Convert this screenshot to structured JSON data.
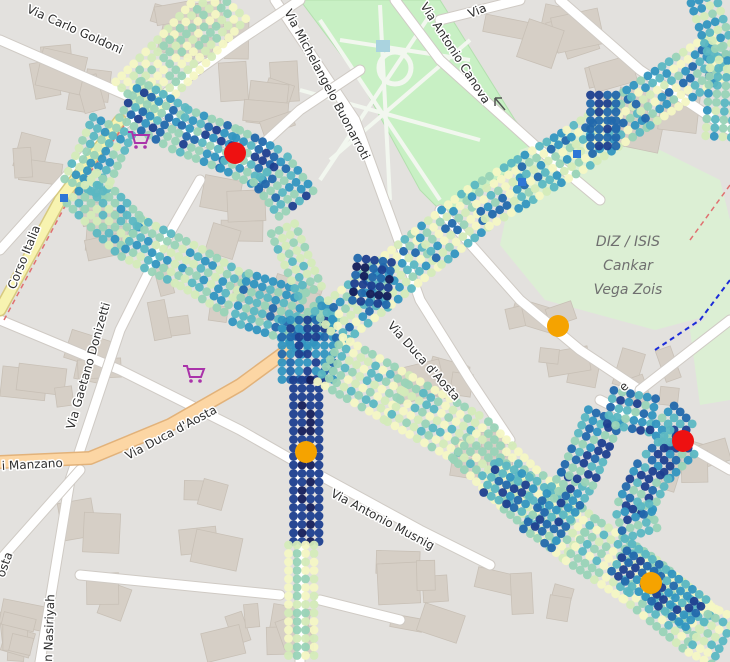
{
  "map": {
    "colors": {
      "background": "#e3e1de",
      "building": "#d6cfc6",
      "building_stroke": "#c8c0b6",
      "park": "#c8f0c4",
      "park_light": "#dcefd4",
      "road": "#ffffff",
      "primary_road": "#fcd6a4",
      "primary_road_stroke": "#e2b27a",
      "rail": "#999999",
      "boundary": "#1b2bd8",
      "point_red": "#ee1111",
      "point_orange": "#f5a300",
      "shop_icon": "#aa33aa",
      "bus_icon": "#2f77d6"
    },
    "heat_palette": [
      "#f4f7c4",
      "#d4ebb9",
      "#99d3b7",
      "#5bb7c2",
      "#3195c0",
      "#2268ac",
      "#1d3f8f",
      "#141e5a"
    ],
    "streets": [
      {
        "name": "Via Carlo Goldoni"
      },
      {
        "name": "Via Michelangelo Buonarroti"
      },
      {
        "name": "Via Antonio Canova"
      },
      {
        "name": "Via"
      },
      {
        "name": "Corso Italia"
      },
      {
        "name": "Via Gaetano Donizetti"
      },
      {
        "name": "Via Duca d'Aosta"
      },
      {
        "name": "Via Duca d'Aosta"
      },
      {
        "name": "i Manzano"
      },
      {
        "name": "Via Antonio Musnig"
      },
      {
        "name": "osta"
      },
      {
        "name": "n Nasiriyah"
      },
      {
        "name": "e"
      }
    ],
    "poi": {
      "label_lines": [
        "DIZ / ISIS",
        "Cankar",
        "Vega Zois"
      ]
    },
    "icons": [
      "shopping-cart-icon",
      "shopping-cart-icon",
      "bus-stop-icon",
      "bus-stop-icon",
      "bus-stop-icon"
    ],
    "markers": [
      {
        "color": "red"
      },
      {
        "color": "red"
      },
      {
        "color": "orange"
      },
      {
        "color": "orange"
      },
      {
        "color": "orange"
      }
    ]
  }
}
